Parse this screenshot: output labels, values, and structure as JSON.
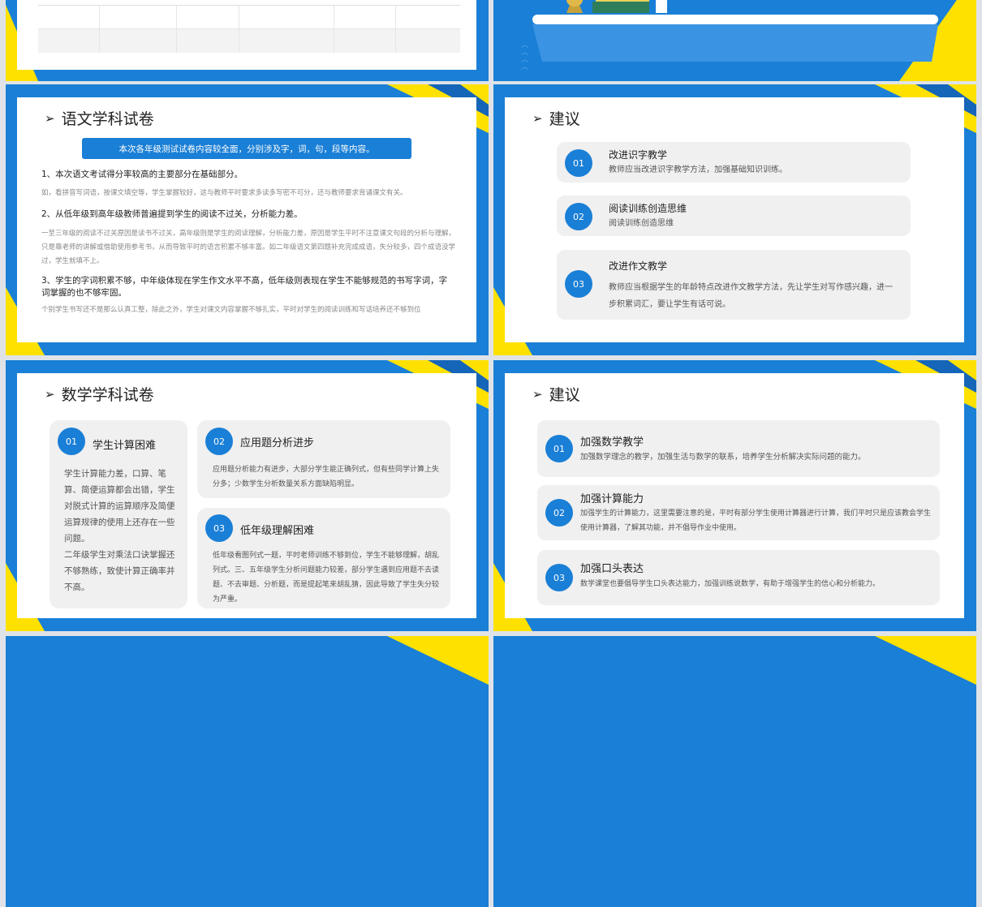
{
  "s3": {
    "title": "语文学科试卷",
    "banner": "本次各年级测试试卷内容较全面，分别涉及字，词，句，段等内容。",
    "h1": "1、本次语文考试得分率较高的主要部分在基础部分。",
    "p1": "如，看拼音写词语，按课文填空等，学生掌握较好，这与教师平时要求多读多写密不可分，还与教师要求背诵课文有关。",
    "h2": "2、从低年级到高年级教师普遍提到学生的阅读不过关，分析能力差。",
    "p2": "一至三年级的阅读不过关原因是读书不过关，高年级则是学生的阅读理解，分析能力差，原因是学生平时不注意课文句段的分析与理解，只是靠老师的讲解或借助使用参考书，从而导致平时的语言积累不够丰富。如二年级语文第四题补充完成成语，失分较多，四个成语没学过，学生就填不上。",
    "h3": "3、学生的字词积累不够，中年级体现在学生作文水平不高，低年级则表现在学生不能够规范的书写字词，字词掌握的也不够牢固。",
    "p3": "个别学生书写还不是那么认真工整，除此之外，学生对课文内容掌握不够扎实，平时对学生的阅读训练和写话培养还不够到位"
  },
  "s4": {
    "title": "建议",
    "items": [
      {
        "num": "01",
        "head": "改进识字教学",
        "desc": "教师应当改进识字教学方法，加强基础知识训练。"
      },
      {
        "num": "02",
        "head": "阅读训练创造思维",
        "desc": "阅读训练创造思维"
      },
      {
        "num": "03",
        "head": "改进作文教学",
        "desc": "教师应当根据学生的年龄特点改进作文教学方法，先让学生对写作感兴趣，进一步积累词汇，要让学生有话可说。"
      }
    ]
  },
  "s5": {
    "title": "数学学科试卷",
    "c1": {
      "num": "01",
      "head": "学生计算困难",
      "desc": "学生计算能力差，口算、笔算、简便运算都会出错，学生对脱式计算的运算顺序及简便运算规律的使用上还存在一些问题。",
      "desc2": "二年级学生对乘法口诀掌握还不够熟练，致使计算正确率并不高。"
    },
    "c2": {
      "num": "02",
      "head": "应用题分析进步",
      "desc": "应用题分析能力有进步，大部分学生能正确列式，但有些同学计算上失分多；少数学生分析数量关系方面缺陷明显。"
    },
    "c3": {
      "num": "03",
      "head": "低年级理解困难",
      "desc": "低年级看图列式一题，平时老师训练不够到位，学生不能够理解，胡乱列式。三、五年级学生分析问题能力较差，部分学生遇到应用题不去读题、不去审题、分析题，而是提起笔来胡乱猜，因此导致了学生失分较为严重。"
    }
  },
  "s6": {
    "title": "建议",
    "items": [
      {
        "num": "01",
        "head": "加强数学教学",
        "desc": "加强数学理念的教学，加强生活与数学的联系，培养学生分析解决实际问题的能力。"
      },
      {
        "num": "02",
        "head": "加强计算能力",
        "desc": "加强学生的计算能力，这里需要注意的是，平时有部分学生使用计算器进行计算，我们平时只是应该教会学生使用计算器，了解其功能，并不倡导作业中使用。"
      },
      {
        "num": "03",
        "head": "加强口头表达",
        "desc": "数学课堂也要倡导学生口头表达能力，加强训练说数学，有助于增强学生的信心和分析能力。"
      }
    ]
  },
  "colors": {
    "blue": "#1a7fd6",
    "yellow": "#ffe100",
    "gray": "#f0f0f0"
  }
}
